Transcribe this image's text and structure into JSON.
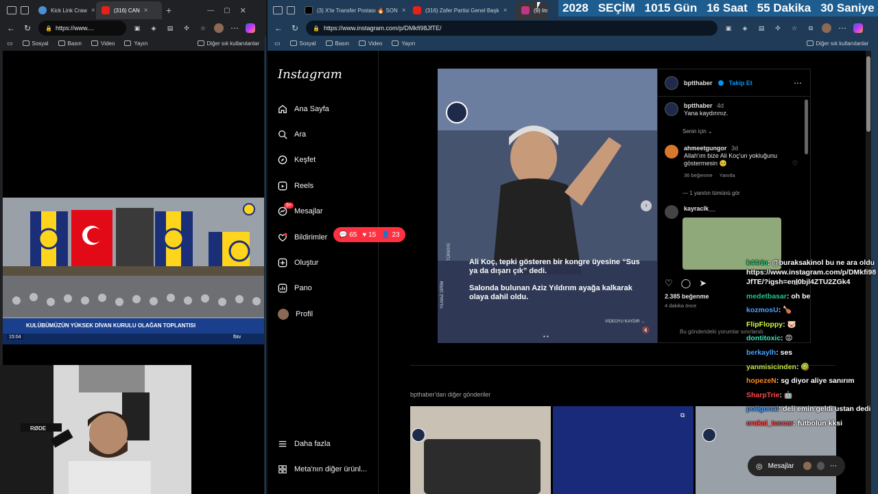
{
  "left_browser": {
    "tabs": [
      {
        "title": "Kick Link Craw",
        "favicon_color": "#4a90d9"
      },
      {
        "title": "(316) CAN",
        "favicon_color": "#e62117",
        "active": true
      }
    ],
    "url": "https://www....",
    "bookmarks": [
      "Sosyal",
      "Basın",
      "Video",
      "Yayın"
    ],
    "bookmarks_right": "Diğer sık kullanılanlar"
  },
  "stage_video": {
    "banner_text": "KULÜBÜMÜZÜN YÜKSEK DİVAN KURULU OLAĞAN TOPLANTISI",
    "clock": "15:04",
    "channel": "fbtv",
    "bg_color": "#7a7e86"
  },
  "right_browser": {
    "tabs": [
      {
        "title": "(3) X'te Transfer Postası 🔥 SON",
        "favicon_color": "#000000"
      },
      {
        "title": "(316) Zafer Partisi Genel Başk",
        "favicon_color": "#e62117"
      },
      {
        "title": "(9) Insta",
        "favicon_color": "#c13584",
        "active": true
      }
    ],
    "url": "https://www.instagram.com/p/DMkfi98JfTE/",
    "bookmarks": [
      "Sosyal",
      "Basın",
      "Video",
      "Yayın"
    ],
    "bookmarks_right": "Diğer sık kullanılanlar"
  },
  "countdown": {
    "year": "2028",
    "label": "SEÇİM",
    "days": "1015 Gün",
    "hours": "16 Saat",
    "minutes": "55 Dakika",
    "seconds": "30 Saniye"
  },
  "instagram": {
    "logo": "Instagram",
    "nav": [
      {
        "label": "Ana Sayfa",
        "icon": "home-icon"
      },
      {
        "label": "Ara",
        "icon": "search-icon"
      },
      {
        "label": "Keşfet",
        "icon": "compass-icon"
      },
      {
        "label": "Reels",
        "icon": "reels-icon"
      },
      {
        "label": "Mesajlar",
        "icon": "messenger-icon",
        "badge": "9+"
      },
      {
        "label": "Bildirimler",
        "icon": "heart-icon"
      },
      {
        "label": "Oluştur",
        "icon": "plus-icon"
      },
      {
        "label": "Pano",
        "icon": "dashboard-icon"
      },
      {
        "label": "Profil",
        "icon": "profile-icon"
      }
    ],
    "nav_bottom": [
      {
        "label": "Daha fazla",
        "icon": "menu-icon"
      },
      {
        "label": "Meta'nın diğer ürünl...",
        "icon": "meta-icon"
      }
    ],
    "notification_pill": {
      "comments": "65",
      "likes": "15",
      "follows": "23"
    },
    "post": {
      "account": "bptthaber",
      "follow_label": "Takip Et",
      "caption_user": "bptthaber",
      "caption_time": "4d",
      "caption": "Yana kaydırınız.",
      "filter_label": "Senin için",
      "headline": "Ali Koç, tepki gösteren bir kongre üyesine “Sus ya da dışarı çık” dedi.",
      "subline": "Salonda bulunan Aziz Yıldırım ayağa kalkarak olaya dahil oldu.",
      "watermark_left": "YILMAZ DİRİM",
      "watermark_right": "TÜRKİYE",
      "swipe_hint": "VİDEOYU KAYDIR →",
      "comments": [
        {
          "user": "ahmeetgungor",
          "time": "3d",
          "text": "Allah'ım bize Ali Koç'un yokluğunu göstermesin 🥺",
          "likes": "36 beğenme",
          "reply": "Yanıtla",
          "view_replies": "1 yanıtın tümünü gör"
        },
        {
          "user": "kayraclk__",
          "time": "",
          "text": "",
          "likes": "",
          "reply": "",
          "view_replies": ""
        }
      ],
      "like_count": "2.385 beğenme",
      "post_time": "4 dakika önce",
      "comment_placeholder": "Bu gönderideki yorumlar sınırlandı."
    },
    "more_posts_label": "bpthaber'dan diğer gönderiler",
    "messages_label": "Mesajlar"
  },
  "chat": [
    {
      "user": "k44rin",
      "user_color": "#29d17a",
      "text": "@buraksakinol bu ne ara oldu https://www.instagram.com/p/DMkfi98JfTE/?igsh=enl0bjl4ZTU2ZGk4"
    },
    {
      "user": "medetbasar",
      "user_color": "#23c98a",
      "text": "oh be"
    },
    {
      "user": "kozmosU",
      "user_color": "#4aa3ff",
      "text": "🍗"
    },
    {
      "user": "FlipFloppy",
      "user_color": "#d4ff3b",
      "text": "🐷"
    },
    {
      "user": "dontitoxic",
      "user_color": "#39e6b5",
      "text": "😡"
    },
    {
      "user": "berkaylh",
      "user_color": "#4aa3ff",
      "text": "ses"
    },
    {
      "user": "yanmisicinden",
      "user_color": "#c3e84a",
      "text": "🥝"
    },
    {
      "user": "hopezeN",
      "user_color": "#ff8c1a",
      "text": "sg diyor aliye sanırım"
    },
    {
      "user": "SharpTrie",
      "user_color": "#ff4646",
      "text": "🤖"
    },
    {
      "user": "poligonal",
      "user_color": "#4aa3ff",
      "text": "deli emin geldi ustan dedi"
    },
    {
      "user": "orakai_tuccar",
      "user_color": "#ff4646",
      "text": "futbolun kksi"
    }
  ]
}
